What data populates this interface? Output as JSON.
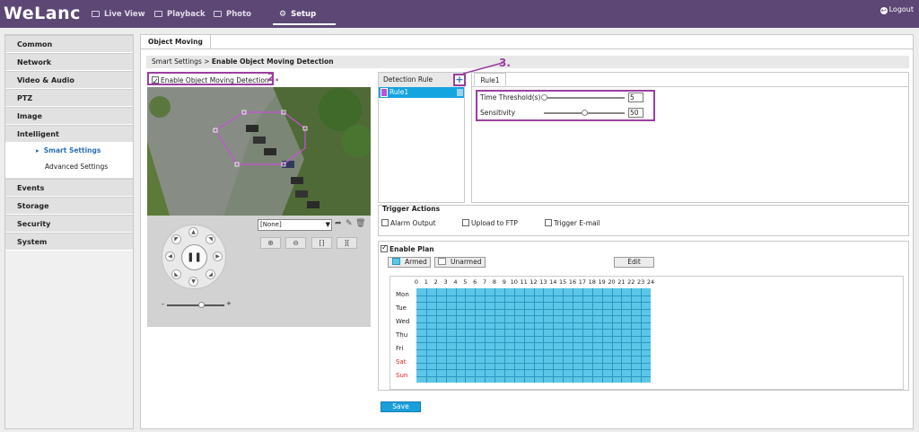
{
  "brand": {
    "logo": "WeLanc",
    "accent": "#5c4775"
  },
  "nav": {
    "live_view": "Live View",
    "playback": "Playback",
    "photo": "Photo",
    "setup": "Setup",
    "logout": "Logout"
  },
  "sidebar": {
    "items": [
      "Common",
      "Network",
      "Video & Audio",
      "PTZ",
      "Image",
      "Intelligent",
      "Events",
      "Storage",
      "Security",
      "System"
    ],
    "sub_items": [
      "Smart Settings",
      "Advanced Settings"
    ],
    "selected_sub": "Smart Settings"
  },
  "page": {
    "tab": "Object Moving",
    "breadcrumb_root": "Smart Settings",
    "breadcrumb_sep": ">",
    "breadcrumb_current": "Enable Object Moving Detection",
    "enable_label": "Enable Object Moving Detection",
    "enable_checked": true
  },
  "annotations": {
    "step2": "2.",
    "step3": "3."
  },
  "ptz": {
    "preset_value": "[None]",
    "zoom_slider_level": 0.6
  },
  "detection": {
    "header": "Detection Rule",
    "add_symbol": "+",
    "rules": [
      "Rule1"
    ],
    "rule_color": "#c050d8",
    "detail_tab": "Rule1",
    "time_threshold_label": "Time Threshold(s)",
    "time_threshold": "5",
    "time_threshold_slider": 0.0,
    "sensitivity_label": "Sensitivity",
    "sensitivity": "50",
    "sensitivity_slider": 0.5
  },
  "trigger": {
    "title": "Trigger Actions",
    "options": [
      {
        "label": "Alarm Output",
        "checked": false
      },
      {
        "label": "Upload to FTP",
        "checked": false
      },
      {
        "label": "Trigger E-mail",
        "checked": false
      }
    ]
  },
  "plan": {
    "title": "Enable Plan",
    "enabled": true,
    "armed_label": "Armed",
    "unarmed_label": "Unarmed",
    "edit_label": "Edit",
    "armed_color": "#5cc6e8",
    "hours": [
      "0",
      "1",
      "2",
      "3",
      "4",
      "5",
      "6",
      "7",
      "8",
      "9",
      "10",
      "11",
      "12",
      "13",
      "14",
      "15",
      "16",
      "17",
      "18",
      "19",
      "20",
      "21",
      "22",
      "23",
      "24"
    ],
    "days": [
      "Mon",
      "Tue",
      "Wed",
      "Thu",
      "Fri",
      "Sat",
      "Sun"
    ],
    "weekend_color": "#e02020"
  },
  "save_label": "Save"
}
